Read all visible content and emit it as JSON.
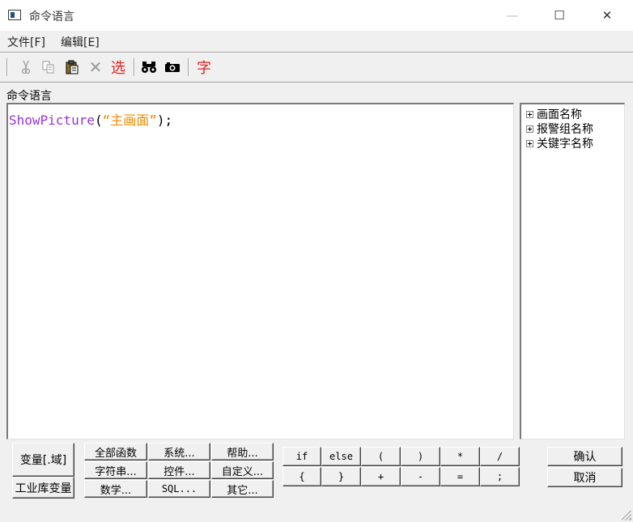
{
  "window": {
    "title": "命令语言",
    "min": "—",
    "max": "☐",
    "close": "✕"
  },
  "menu": [
    "文件[F]",
    "编辑[E]"
  ],
  "toolbar": {
    "cut_icon": "scissors-icon",
    "copy_icon": "copy-icon",
    "paste_icon": "clipboard-icon",
    "delete_label": "✕",
    "select_label": "选",
    "find_icon": "binoculars-icon",
    "camera_icon": "camera-icon",
    "font_label": "字"
  },
  "section_label": "命令语言",
  "code": {
    "fn": "ShowPicture",
    "open": "(",
    "str": "“主画面”",
    "close": ");"
  },
  "tree": [
    "画面名称",
    "报警组名称",
    "关键字名称"
  ],
  "buttons": {
    "variable_field": "变量[.域]",
    "industrial_db_var": "工业库变量",
    "all_functions": "全部函数",
    "system": "系统...",
    "help": "帮助...",
    "string": "字符串...",
    "control": "控件...",
    "custom": "自定义...",
    "math": "数学...",
    "sql": "SQL...",
    "other": "其它..."
  },
  "operators_row1": [
    "if",
    "else",
    "(",
    ")",
    "*",
    "/"
  ],
  "operators_row2": [
    "{",
    "}",
    "+",
    "-",
    "=",
    ";"
  ],
  "confirm": "确认",
  "cancel": "取消",
  "colors": {
    "function": "#9b30d9",
    "string": "#f08a00",
    "toolbar_red": "#e02020"
  }
}
